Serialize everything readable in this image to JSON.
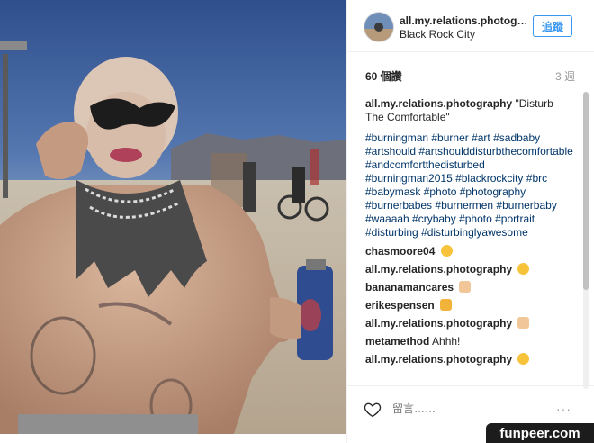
{
  "post": {
    "username": "all.my.relations.photog…",
    "location": "Black Rock City",
    "follow_label": "追蹤",
    "likes": "60 個讚",
    "time_ago": "3 週"
  },
  "caption": {
    "username": "all.my.relations.photography",
    "text": "\"Disturb The Comfortable\"",
    "hashtags": "#burningman #burner #art #sadbaby #artshould #artshoulddisturbthecomfortable #andcomfortthedisturbed #burningman2015 #blackrockcity #brc #babymask #photo #photography #burnerbabes #burnermen #burnerbaby #waaaah #crybaby #photo #portrait #disturbing #disturbinglyawesome"
  },
  "comments": [
    {
      "user": "chasmoore04",
      "text": "",
      "emoji": "sunglasses-emoji",
      "color": "#f7c33b"
    },
    {
      "user": "all.my.relations.photography",
      "text": "",
      "emoji": "grimace-emoji",
      "color": "#f7c33b"
    },
    {
      "user": "bananamancares",
      "text": "",
      "emoji": "raised-hands-emoji",
      "color": "#f1c79a"
    },
    {
      "user": "erikespensen",
      "text": "",
      "emoji": "ok-hand-emoji",
      "color": "#f2b33a"
    },
    {
      "user": "all.my.relations.photography",
      "text": "",
      "emoji": "thumbs-up-emoji",
      "color": "#f1c79a"
    },
    {
      "user": "metamethod",
      "text": "Ahhh!",
      "emoji": "",
      "color": ""
    },
    {
      "user": "all.my.relations.photography",
      "text": "",
      "emoji": "wink-emoji",
      "color": "#f7c33b"
    }
  ],
  "footer": {
    "comment_placeholder": "留言……",
    "more_label": "···"
  },
  "watermark": "funpeer.com",
  "colors": {
    "link": "#003569",
    "follow": "#3897f0",
    "sky": "#5d6e8a"
  }
}
